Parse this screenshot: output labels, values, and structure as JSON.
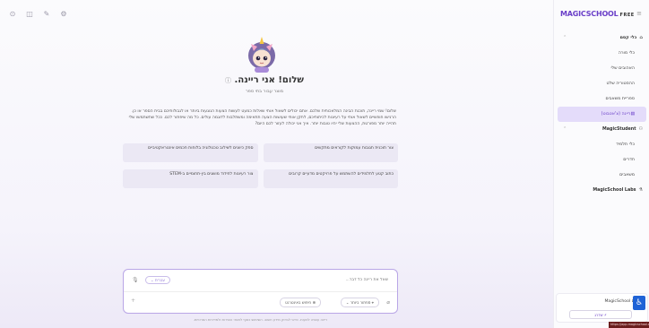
{
  "topbar": {
    "icons": [
      "help-icon",
      "bookmark-icon",
      "tools-icon",
      "settings-icon"
    ],
    "glyphs": [
      "⊙",
      "◫",
      "✎",
      "⚙"
    ]
  },
  "bot": {
    "title": "שלום! אני ריינה.",
    "info_glyph": "ⓘ",
    "subtitle": "מוצר עבור בתי ספר",
    "description": "שלום! שמי ריינה, תוכנת הבינה המלאכותית שלכם. אתם יכולים לשאול אותי שאלות כמעט לעשות הצעות הנוגעות ביותר או לגבולותיכם בבית הספר או כן. הרגישו חופשיים לשאול אותי על רעיונות לכיתותיכם, לתקן אותי שעושות הצעה תתאימה ומשתלבות לדוגמה עולים. כל מה שיפתור לכם. ככל שתשתמשו שלי תהייה יותר מפורטת, ההצעות שלי יהיו טובות יותר. איך אני יכולה לעזור לכם היום?",
    "suggestions": [
      "צור תוכנית תגובות עמוקות לקוראים מתקשים",
      "ספק כיוונים לשילוב טכנולוגיה בלוחות חכמים אינטראקטיביים",
      "כתוב קטע לתלמידים להשתמש על פרויקטים מדעיים קרובים",
      "צור רעיונות לחידוד מושגים בין-תחומיים ב-STEM"
    ]
  },
  "chat": {
    "placeholder": "שאל את ריינה כל דבר...",
    "lang_label": "עברית",
    "model_label": "ספתור ביותר",
    "search_label": "חיפוש באינטרנט",
    "disclaimer": "ריינה עשויה לטעות. כדאי לבדוק מידע חשוב. השימוש כפוף לתנאי השירות ולמדיניות הפרטיות."
  },
  "sidebar": {
    "brand": "MAGICSCHOOL",
    "plan": "FREE",
    "items": [
      {
        "label": "כלי קסם",
        "type": "section",
        "icon": "⌂",
        "chev": "⌃"
      },
      {
        "label": "כלי מורה",
        "type": "item"
      },
      {
        "label": "האהובים שלי",
        "type": "item"
      },
      {
        "label": "ההסטוריה שלט",
        "type": "item"
      },
      {
        "label": "ספריית משאבים",
        "type": "item"
      },
      {
        "label": "ריינה (צ'אטבוט)",
        "type": "active",
        "icon": "▤"
      },
      {
        "label": "MagicStudent",
        "type": "section",
        "icon": "⚇",
        "chev": "⌃"
      },
      {
        "label": "כלי תלמיד",
        "type": "item"
      },
      {
        "label": "חדרים",
        "type": "item"
      },
      {
        "label": "משאבים",
        "type": "item"
      },
      {
        "label": "MagicSchool Labs",
        "type": "section",
        "icon": "⚗"
      }
    ],
    "upgrade": {
      "title": "היום MagicSchool",
      "button": "שדרג ⚡"
    }
  },
  "footer": {
    "url": "https://app.magicschool.ai/tools/raina"
  }
}
